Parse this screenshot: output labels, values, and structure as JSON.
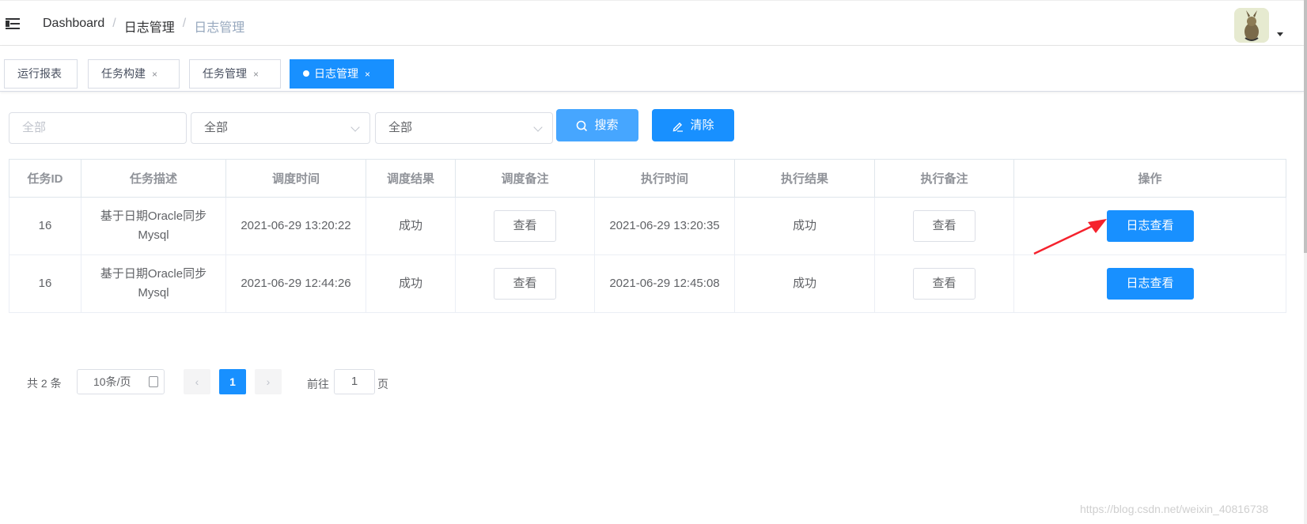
{
  "breadcrumb": [
    "Dashboard",
    "日志管理",
    "日志管理"
  ],
  "tags": [
    {
      "label": "运行报表",
      "closable": false,
      "active": false
    },
    {
      "label": "任务构建",
      "closable": true,
      "active": false
    },
    {
      "label": "任务管理",
      "closable": true,
      "active": false
    },
    {
      "label": "日志管理",
      "closable": true,
      "active": true
    }
  ],
  "tag_close_glyph": "×",
  "filters": {
    "job_placeholder": "全部",
    "select1_value": "全部",
    "select2_value": "全部",
    "search_label": "搜索",
    "clear_label": "清除"
  },
  "table": {
    "columns": [
      "任务ID",
      "任务描述",
      "调度时间",
      "调度结果",
      "调度备注",
      "执行时间",
      "执行结果",
      "执行备注",
      "操作"
    ],
    "rows": [
      {
        "id": "16",
        "desc": "基于日期Oracle同步Mysql",
        "trigger_time": "2021-06-29 13:20:22",
        "trigger_result": "成功",
        "trigger_msg": "查看",
        "handle_time": "2021-06-29 13:20:35",
        "handle_result": "成功",
        "handle_msg": "查看",
        "action": "日志查看"
      },
      {
        "id": "16",
        "desc": "基于日期Oracle同步Mysql",
        "trigger_time": "2021-06-29 12:44:26",
        "trigger_result": "成功",
        "trigger_msg": "查看",
        "handle_time": "2021-06-29 12:45:08",
        "handle_result": "成功",
        "handle_msg": "查看",
        "action": "日志查看"
      }
    ]
  },
  "pagination": {
    "total_text": "共 2 条",
    "page_size": "10条/页",
    "current_page": "1",
    "goto_label": "前往",
    "goto_value": "1",
    "page_unit": "页"
  },
  "watermark": "https://blog.csdn.net/weixin_40816738",
  "colors": {
    "primary": "#1890ff",
    "search": "#46a6ff",
    "arrow": "#f5222d"
  }
}
